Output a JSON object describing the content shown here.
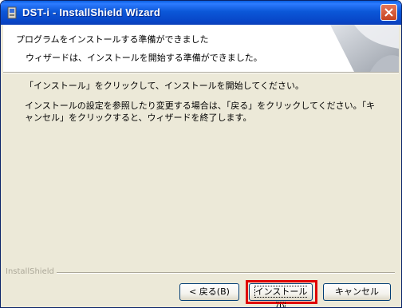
{
  "window": {
    "title": "DST-i - InstallShield Wizard",
    "app_icon": "installer-icon",
    "close_icon": "close-icon"
  },
  "header": {
    "title": "プログラムをインストールする準備ができました",
    "subtitle": "ウィザードは、インストールを開始する準備ができました。"
  },
  "body": {
    "line1": "「インストール」をクリックして、インストールを開始してください。",
    "line2": "インストールの設定を参照したり変更する場合は、「戻る」をクリックしてください。「キャンセル」をクリックすると、ウィザードを終了します。"
  },
  "footer": {
    "brand": "InstallShield"
  },
  "buttons": {
    "back": "< 戻る(B)",
    "install": "インストール(I)",
    "cancel": "キャンセル"
  },
  "colors": {
    "titlebar": "#0a57d8",
    "dialog_bg": "#ece9d8",
    "highlight": "#e00000"
  }
}
